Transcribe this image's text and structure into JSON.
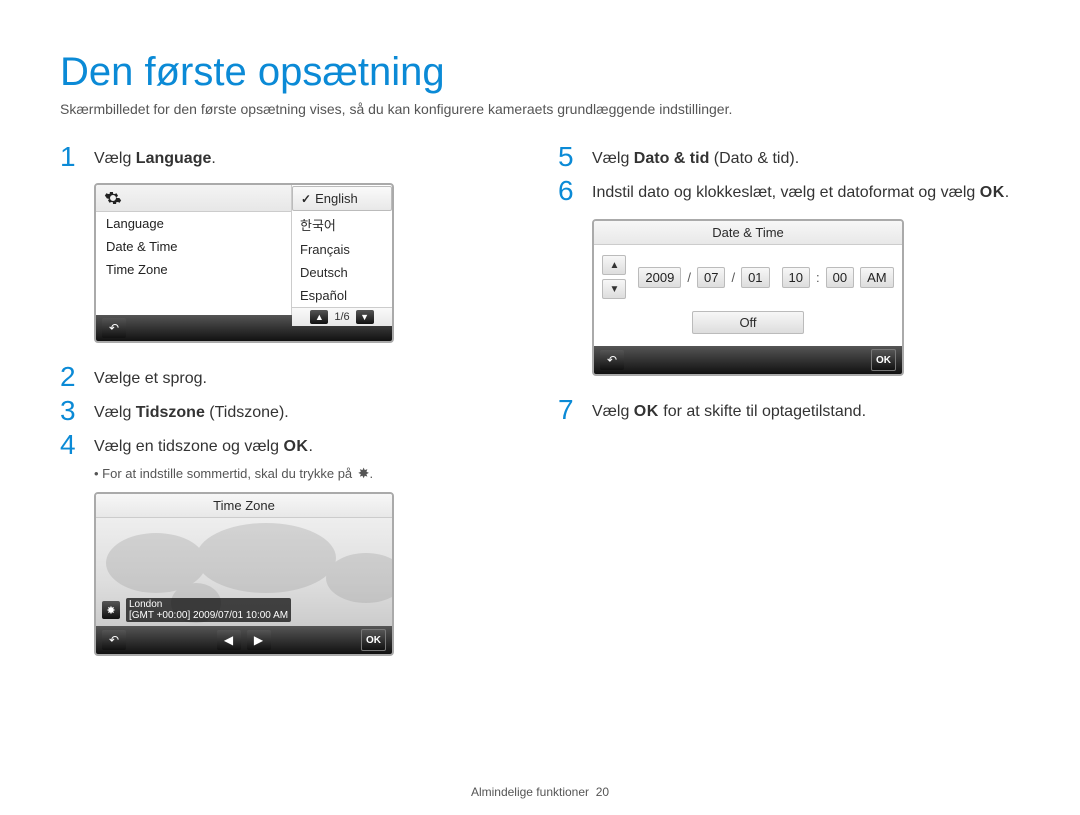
{
  "title": "Den første opsætning",
  "intro": "Skærmbilledet for den første opsætning vises, så du kan konfigurere kameraets grundlæggende indstillinger.",
  "steps": {
    "s1": {
      "num": "1",
      "pre": "Vælg ",
      "bold": "Language",
      "post": "."
    },
    "s2": {
      "num": "2",
      "text": "Vælge et sprog."
    },
    "s3": {
      "num": "3",
      "pre": "Vælg ",
      "bold": "Tidszone",
      "post": " (Tidszone)."
    },
    "s4": {
      "num": "4",
      "pre": "Vælg en tidszone og vælg ",
      "ok": "OK",
      "post": "."
    },
    "s4_note": "For at indstille sommertid, skal du trykke på ",
    "s5": {
      "num": "5",
      "pre": "Vælg ",
      "bold": "Dato & tid",
      "post": " (Dato & tid)."
    },
    "s6": {
      "num": "6",
      "pre": "Indstil dato og klokkeslæt, vælg et datoformat og vælg ",
      "ok": "OK",
      "post": "."
    },
    "s7": {
      "num": "7",
      "pre": "Vælg ",
      "ok": "OK",
      "post": " for at skifte til optagetilstand."
    }
  },
  "lang_screen": {
    "left_items": [
      "Language",
      "Date & Time",
      "Time Zone"
    ],
    "options": [
      "English",
      "한국어",
      "Français",
      "Deutsch",
      "Español"
    ],
    "pager": "1/6"
  },
  "tz_screen": {
    "title": "Time Zone",
    "city": "London",
    "detail": "[GMT +00:00] 2009/07/01 10:00 AM",
    "ok": "OK"
  },
  "dt_screen": {
    "title": "Date & Time",
    "year": "2009",
    "month": "07",
    "day": "01",
    "hour": "10",
    "minute": "00",
    "ampm": "AM",
    "sep_slash": "/",
    "sep_colon": ":",
    "off": "Off",
    "ok": "OK"
  },
  "footer": {
    "label": "Almindelige funktioner",
    "page": "20"
  }
}
